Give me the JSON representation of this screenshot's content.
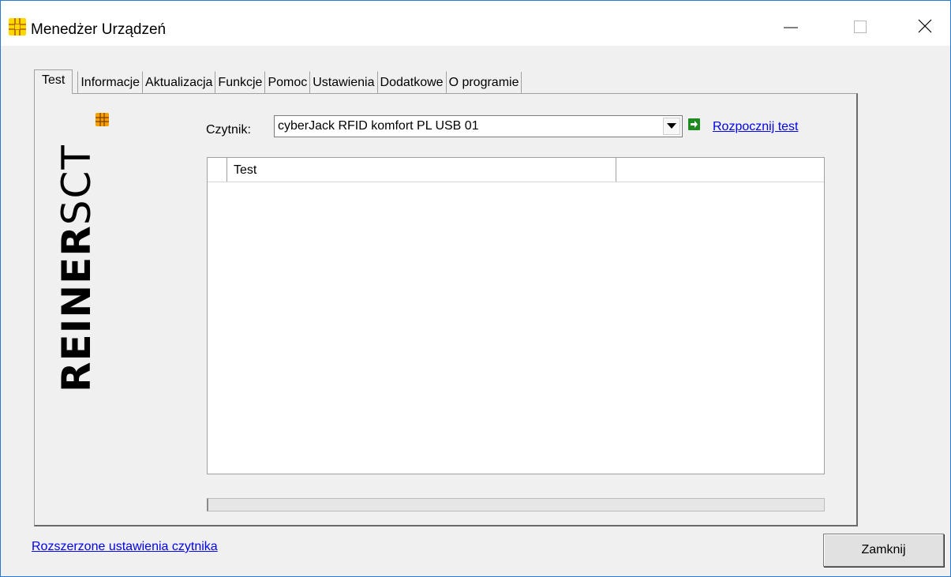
{
  "window": {
    "title": "Menedżer Urządzeń"
  },
  "tabs": [
    {
      "label": "Test",
      "active": true
    },
    {
      "label": "Informacje"
    },
    {
      "label": "Aktualizacja"
    },
    {
      "label": "Funkcje"
    },
    {
      "label": "Pomoc"
    },
    {
      "label": "Ustawienia"
    },
    {
      "label": "Dodatkowe"
    },
    {
      "label": "O programie"
    }
  ],
  "logo": {
    "text_bold": "REINER",
    "text_light": "SCT",
    "icon": "chip-icon",
    "accent_color": "#f5a000"
  },
  "reader": {
    "label": "Czytnik:",
    "selected": "cyberJack RFID komfort PL USB 01",
    "start_label": "Rozpocznij test"
  },
  "results_table": {
    "columns": [
      "",
      "Test",
      ""
    ],
    "rows": []
  },
  "progress": 0,
  "footer": {
    "advanced_link": "Rozszerzone ustawienia czytnika",
    "close_label": "Zamknij"
  }
}
